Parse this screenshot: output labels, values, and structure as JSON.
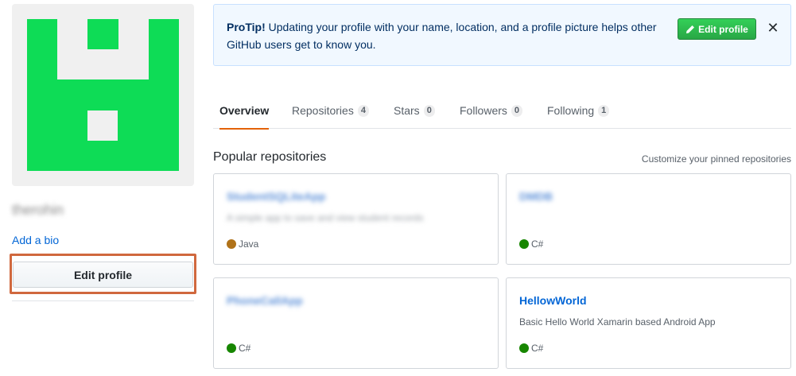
{
  "profile": {
    "username": "therohin",
    "add_bio": "Add a bio",
    "edit_profile": "Edit profile",
    "avatar_color": "#0edc56"
  },
  "protip": {
    "label": "ProTip!",
    "text": " Updating your profile with your name, location, and a profile picture helps other GitHub users get to know you.",
    "button": "Edit profile",
    "close": "✕"
  },
  "tabs": [
    {
      "label": "Overview"
    },
    {
      "label": "Repositories",
      "count": "4"
    },
    {
      "label": "Stars",
      "count": "0"
    },
    {
      "label": "Followers",
      "count": "0"
    },
    {
      "label": "Following",
      "count": "1"
    }
  ],
  "repos_section": {
    "title": "Popular repositories",
    "customize": "Customize your pinned repositories",
    "items": [
      {
        "name": "StudentSQLiteApp",
        "desc": "A simple app to save and view student records",
        "lang": "Java",
        "lang_color": "#b07219"
      },
      {
        "name": "DMDB",
        "desc": "",
        "lang": "C#",
        "lang_color": "#178600"
      },
      {
        "name": "PhoneCallApp",
        "desc": "",
        "lang": "C#",
        "lang_color": "#178600"
      },
      {
        "name": "HellowWorld",
        "desc": "Basic Hello World Xamarin based Android App",
        "lang": "C#",
        "lang_color": "#178600"
      }
    ]
  }
}
